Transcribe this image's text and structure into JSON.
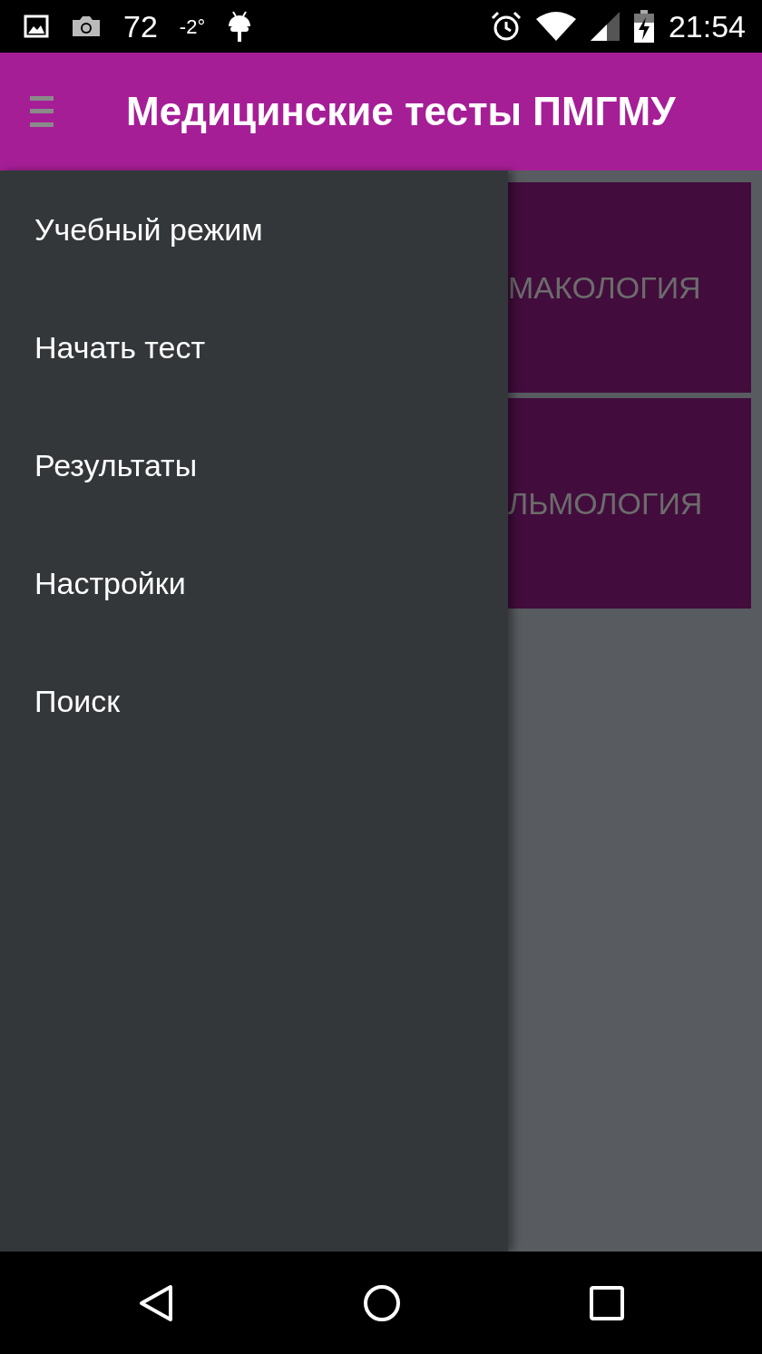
{
  "status_bar": {
    "left_texts": [
      "72",
      "-2°"
    ],
    "time": "21:54"
  },
  "app_bar": {
    "title": "Медицинские тесты ПМГМУ"
  },
  "drawer": {
    "items": [
      {
        "label": "Учебный режим"
      },
      {
        "label": "Начать тест"
      },
      {
        "label": "Результаты"
      },
      {
        "label": "Настройки"
      },
      {
        "label": "Поиск"
      }
    ]
  },
  "categories": [
    {
      "label": "МАКОЛОГИЯ"
    },
    {
      "label": "ЛЬМОЛОГИЯ"
    }
  ]
}
